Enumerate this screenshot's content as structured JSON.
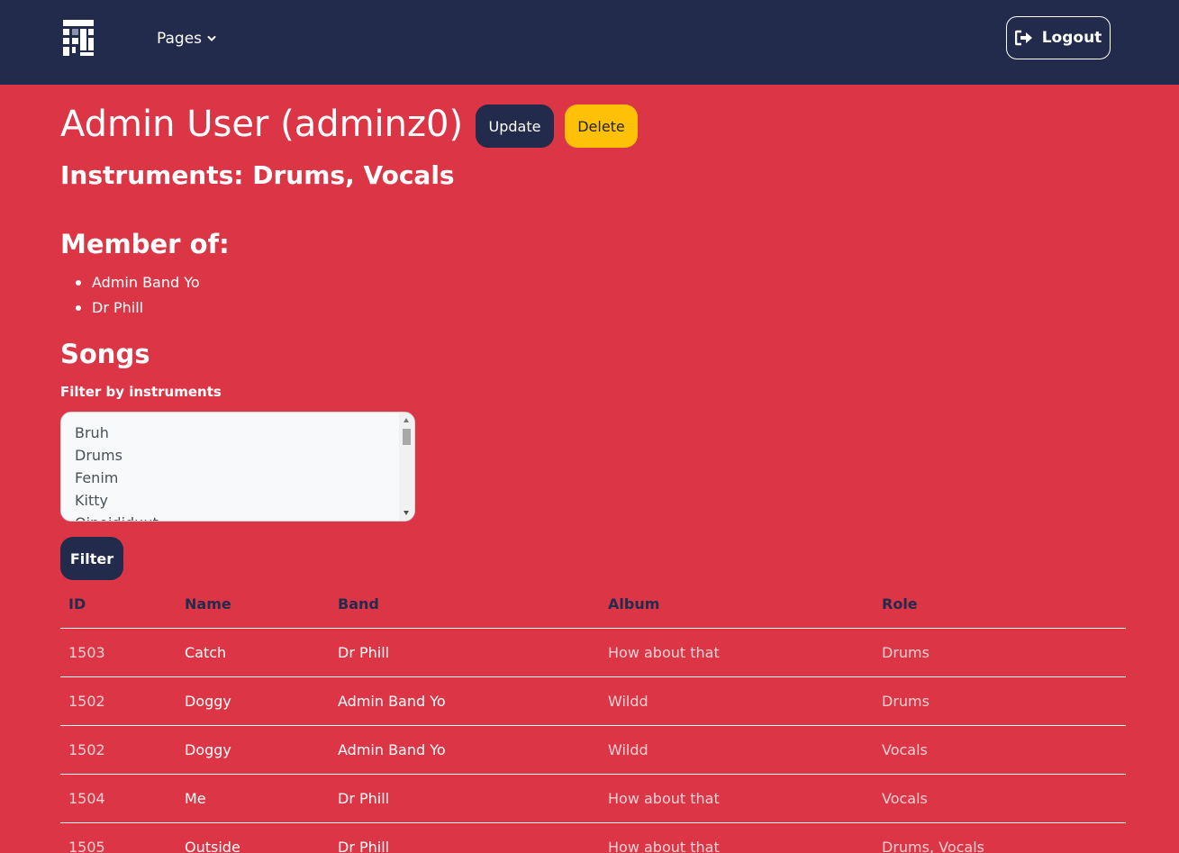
{
  "navbar": {
    "pages_label": "Pages",
    "logout_label": "Logout"
  },
  "profile": {
    "title": "Admin User (adminz0)",
    "update_label": "Update",
    "delete_label": "Delete",
    "instruments": "Instruments: Drums, Vocals",
    "member_heading": "Member of:",
    "bands": [
      "Admin Band Yo",
      "Dr Phill"
    ]
  },
  "songs": {
    "heading": "Songs",
    "filter_label": "Filter by instruments",
    "instrument_options": [
      "Bruh",
      "Drums",
      "Fenim",
      "Kitty",
      "Oinoididuut"
    ],
    "filter_button_label": "Filter",
    "columns": [
      "ID",
      "Name",
      "Band",
      "Album",
      "Role"
    ],
    "rows": [
      {
        "id": "1503",
        "name": "Catch",
        "band": "Dr Phill",
        "album": "How about that",
        "role": "Drums"
      },
      {
        "id": "1502",
        "name": "Doggy",
        "band": "Admin Band Yo",
        "album": "Wildd",
        "role": "Drums"
      },
      {
        "id": "1502",
        "name": "Doggy",
        "band": "Admin Band Yo",
        "album": "Wildd",
        "role": "Vocals"
      },
      {
        "id": "1504",
        "name": "Me",
        "band": "Dr Phill",
        "album": "How about that",
        "role": "Vocals"
      },
      {
        "id": "1505",
        "name": "Outside",
        "band": "Dr Phill",
        "album": "How about that",
        "role": "Drums, Vocals"
      }
    ]
  },
  "colors": {
    "background": "#dc3545",
    "navbar": "#232b4c",
    "primary_button": "#232b4c",
    "warning_button": "#ffc107"
  }
}
